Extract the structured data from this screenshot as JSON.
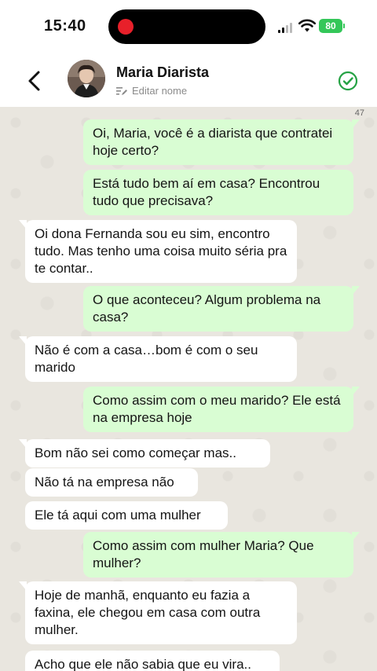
{
  "status_bar": {
    "time": "15:40",
    "battery": "80"
  },
  "header": {
    "contact_name": "Maria Diarista",
    "edit_name_label": "Editar nome"
  },
  "chat": {
    "message_count": "47",
    "messages": [
      {
        "direction": "out",
        "text": "Oi, Maria, você é a diarista que contratei hoje certo?"
      },
      {
        "direction": "out",
        "text": "Está tudo bem aí em casa? Encontrou tudo que precisava?"
      },
      {
        "direction": "in",
        "text": "Oi dona Fernanda sou eu sim, encontro tudo. Mas tenho uma coisa muito séria pra te contar.."
      },
      {
        "direction": "out",
        "text": "O que aconteceu? Algum problema na casa?"
      },
      {
        "direction": "in",
        "text": "Não é com a casa…bom é com o seu marido"
      },
      {
        "direction": "out",
        "text": "Como assim com o meu marido? Ele está na empresa hoje"
      },
      {
        "direction": "in",
        "text": "Bom não sei como começar mas.."
      },
      {
        "direction": "in",
        "text": "Não tá na empresa não"
      },
      {
        "direction": "in",
        "text": "Ele tá aqui com uma mulher"
      },
      {
        "direction": "out",
        "text": "Como assim com mulher Maria? Que mulher?"
      },
      {
        "direction": "in",
        "text": "Hoje de manhã, enquanto eu fazia a faxina, ele chegou em casa com outra mulher."
      },
      {
        "direction": "in",
        "text": "Acho que ele não sabia que eu vira.."
      }
    ]
  },
  "colors": {
    "outgoing_bubble": "#d9fdd3",
    "incoming_bubble": "#ffffff",
    "chat_background": "#e9e6df",
    "verified_icon": "#25a244"
  },
  "icons": [
    "back-icon",
    "avatar",
    "pencil-lines-icon",
    "check-circle-icon",
    "signal-icon",
    "wifi-icon",
    "battery-icon"
  ]
}
